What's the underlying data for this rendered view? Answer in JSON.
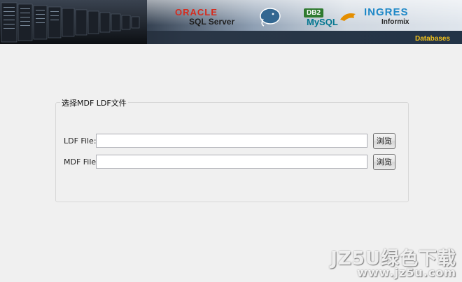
{
  "banner": {
    "logos": {
      "oracle": "ORACLE",
      "sqlserver": "SQL Server",
      "postgresql": "elephant-icon",
      "db2": "DB2",
      "mysql": "MySQL",
      "ingres": "INGRES",
      "informix": "Informix"
    },
    "tag": "Databases"
  },
  "form": {
    "group_title": "选择MDF LDF文件",
    "ldf": {
      "label": "LDF File:",
      "value": "",
      "button": "浏览"
    },
    "mdf": {
      "label": "MDF File:",
      "value": "",
      "button": "浏览"
    }
  },
  "watermark": {
    "line1": "JZ5U绿色下载",
    "line2": "www.jz5u.com"
  },
  "colors": {
    "background": "#f0f0f0",
    "banner_tag": "#f2c21b",
    "oracle_red": "#d52b1e",
    "input_border": "#abadb3"
  }
}
